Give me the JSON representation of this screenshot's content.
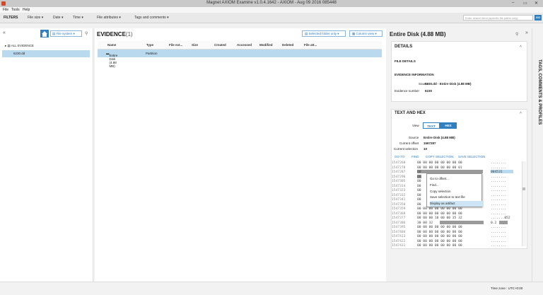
{
  "window": {
    "title": "Magnet AXIOM Examine v1.0.4.1642 - AXIOM - Aug 09 2016 085448",
    "controls": [
      "–",
      "▭",
      "✕"
    ]
  },
  "menu": [
    "File",
    "Tools",
    "Help"
  ],
  "filters": {
    "label": "FILTERS",
    "items": [
      "File size",
      "Date",
      "Time",
      "File attributes",
      "Tags and comments"
    ],
    "search_placeholder": "Enter search term (specific file paths only)",
    "go_label": "GO"
  },
  "left": {
    "source_button": "File system",
    "tree": {
      "root": "ALL EVIDENCE",
      "child": "6230.dd"
    }
  },
  "evidence": {
    "title": "EVIDENCE",
    "count": "(1)",
    "selected_folder_button": "Selected folder only",
    "column_view_button": "Column view",
    "columns": [
      "Name",
      "Type",
      "File ext...",
      "Size",
      "Created",
      "Accessed",
      "Modified",
      "Deleted",
      "File att..."
    ],
    "row": {
      "name": "Entire Disk (4.88 MB)",
      "type": "Partition"
    }
  },
  "details": {
    "panel_title": "Entire Disk (4.88 MB)",
    "section": "DETAILS",
    "file_details": "FILE DETAILS",
    "evidence_info": "EVIDENCE INFORMATION",
    "source_label": "Source",
    "source_value": "6230.dd - Entire Disk (4.88 MB)",
    "evnum_label": "Evidence number",
    "evnum_value": "6230"
  },
  "texthex": {
    "section": "TEXT AND HEX",
    "view_label": "View",
    "text_btn": "TEXT",
    "hex_btn": "HEX",
    "source_label": "Source",
    "source_value": "Entire Disk (4.88 MB)",
    "offset_label": "Current offset",
    "offset_value": "1567287",
    "sel_label": "Current selection",
    "sel_value": "10",
    "links": [
      "GO TO",
      "FIND",
      "COPY SELECTION",
      "SAVE SELECTION"
    ],
    "rows": [
      {
        "off": "1547260",
        "hex": "00 00 00 00 00 00 00 00",
        "asc": "........"
      },
      {
        "off": "1547278",
        "hex": "00 00 00 00 00 00 00 01",
        "asc": "........"
      },
      {
        "off": "1547287",
        "hex": "00",
        "asc": "004531"
      },
      {
        "off": "1547296",
        "hex": "00",
        "asc": "........"
      },
      {
        "off": "1547305",
        "hex": "00",
        "asc": "........"
      },
      {
        "off": "1547314",
        "hex": "00",
        "asc": "........"
      },
      {
        "off": "1547323",
        "hex": "00",
        "asc": "........"
      },
      {
        "off": "1547332",
        "hex": "00",
        "asc": "........"
      },
      {
        "off": "1547341",
        "hex": "00",
        "asc": "........"
      },
      {
        "off": "1547350",
        "hex": "00",
        "asc": "........"
      },
      {
        "off": "1547359",
        "hex": "00 00 00 00 00 00 00 00",
        "asc": "........"
      },
      {
        "off": "1547368",
        "hex": "00 00 00 00 00 00 00 00",
        "asc": "........"
      },
      {
        "off": "1547377",
        "hex": "00 00 00 10 00 00 35 32",
        "asc": ".......052"
      },
      {
        "off": "1547386",
        "hex": "30 00 32",
        "asc": "0.2"
      },
      {
        "off": "1547395",
        "hex": "00 00 00 00 00 00 00 00",
        "asc": "........"
      },
      {
        "off": "1547404",
        "hex": "00 00 00 00 00 00 00 00",
        "asc": "........"
      },
      {
        "off": "1547413",
        "hex": "00 00 00 00 00 00 00 00",
        "asc": "........"
      },
      {
        "off": "1547422",
        "hex": "00 00 00 00 00 00 00 00",
        "asc": "........"
      },
      {
        "off": "1547431",
        "hex": "00 00 00 00 00 00 00 00",
        "asc": "........"
      }
    ],
    "context_menu": [
      "Go to offset...",
      "Find...",
      "Copy selection",
      "Save selection to text file",
      "Display as artifact"
    ]
  },
  "side_tab": "TAGS, COMMENTS & PROFILES",
  "status": {
    "timezone": "Time zone : UTC+0:00"
  }
}
